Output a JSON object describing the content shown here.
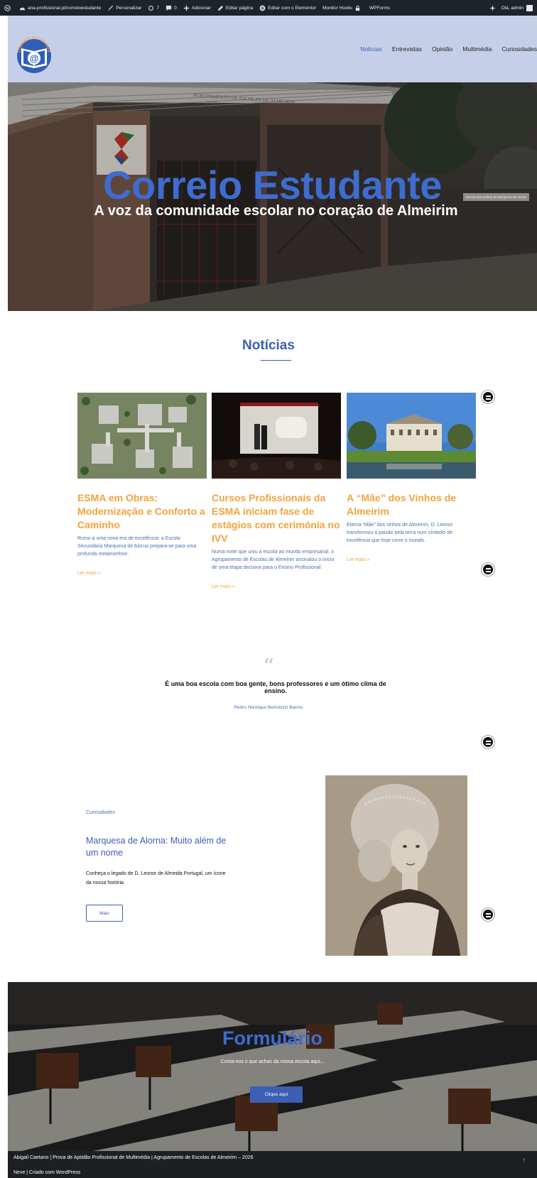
{
  "admin_bar": {
    "site": "ana-profissional.pt/correioestudante",
    "customize": "Personalizar",
    "updates": "7",
    "comments": "0",
    "add": "Adicionar",
    "edit_page": "Editar página",
    "elementor": "Editar com o Elementor",
    "hooks": "Monitor Hooks",
    "wpforms": "WPForms",
    "greeting": "Olá, admin"
  },
  "header": {
    "logo_text": "CORREIO ESTUDANTE",
    "logo_symbol": "@",
    "nav": [
      {
        "label": "Notícias",
        "active": true
      },
      {
        "label": "Entrevistas"
      },
      {
        "label": "Opinião"
      },
      {
        "label": "Multimédia"
      },
      {
        "label": "Curiosidades"
      }
    ]
  },
  "hero": {
    "title": "Correio Estudante",
    "subtitle": "A voz da comunidade escolar no coração de Almeirim",
    "building_sign": "AGRUPAMENTO DE ESCOLAS DE ALMEIRIM",
    "building_sign_2": "SEDE",
    "plaque": "Escola Secundária da Marquesa de Alorna"
  },
  "news": {
    "title": "Notícias",
    "posts": [
      {
        "title": "ESMA em Obras: Modernização e Conforto a Caminho",
        "excerpt": "Rumo a uma nova era de excelência: a Escola Secundária Marquesa de Alorna prepara-se para uma profunda metamorfose.",
        "more": "Ler mais »"
      },
      {
        "title": "Cursos Profissionais da ESMA iniciam fase de estágios com cerimónia no IVV",
        "excerpt": "Numa noite que uniu a escola ao mundo empresarial, o Agrupamento de Escolas de Almeirim assinalou o início de uma etapa decisiva para o Ensino Profissional.",
        "more": "Ler mais »"
      },
      {
        "title": "A “Mãe” dos Vinhos de Almeirim",
        "excerpt": "Eterna “Mãe” dos vinhos de Almeirim, D. Leonor transformou a paixão pela terra num símbolo de excelência que hoje corre o mundo.",
        "more": "Ler mais »"
      }
    ]
  },
  "testimonial": {
    "mark": "“",
    "text": "É uma boa escola com boa gente, bons professores e um ótimo clima de ensino.",
    "author": "Pedro Henrique Bertolozzi Barros"
  },
  "feature": {
    "category": "Curiosidades",
    "title": "Marquesa de Alorna: Muito além de um nome",
    "description": "Conheça o legado de D. Leonor de Almeida Portugal, um ícone da nossa história.",
    "button": "Mais"
  },
  "form_section": {
    "title": "Formulário",
    "subtitle": "Conta-nos o que achas da nossa escola aqui...",
    "button": "Clique aqui"
  },
  "footer": {
    "line1": "Abigail Caetano | Prova de Aptidão Profissional de Multimédia | Agrupamento de Escolas de Almeirim – 2026",
    "line2": "Neve | Criado com WordPress",
    "to_top": "↑"
  },
  "colors": {
    "accent_blue": "#3b5fb5",
    "hero_blue": "#3e6ccf",
    "orange": "#f2a33a",
    "header_bg": "#c5cfe8",
    "admin_bg": "#1d2327"
  }
}
